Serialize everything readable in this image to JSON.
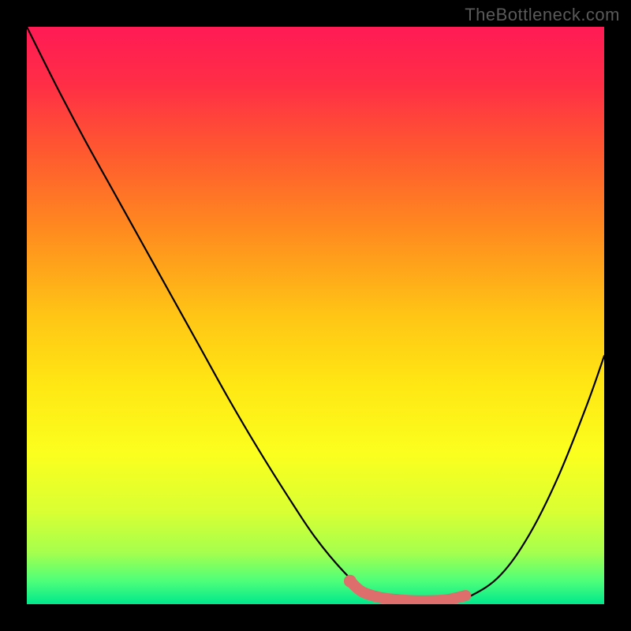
{
  "watermark": "TheBottleneck.com",
  "gradient": {
    "stops": [
      {
        "offset": 0.0,
        "color": "#ff1a55"
      },
      {
        "offset": 0.1,
        "color": "#ff2e46"
      },
      {
        "offset": 0.22,
        "color": "#ff5a2f"
      },
      {
        "offset": 0.35,
        "color": "#ff8a1f"
      },
      {
        "offset": 0.5,
        "color": "#ffc515"
      },
      {
        "offset": 0.62,
        "color": "#ffe714"
      },
      {
        "offset": 0.74,
        "color": "#fbff1e"
      },
      {
        "offset": 0.84,
        "color": "#d9ff33"
      },
      {
        "offset": 0.91,
        "color": "#a6ff4d"
      },
      {
        "offset": 0.96,
        "color": "#4dff79"
      },
      {
        "offset": 1.0,
        "color": "#00e88c"
      }
    ]
  },
  "chart_data": {
    "type": "line",
    "title": "",
    "xlabel": "",
    "ylabel": "",
    "xlim": [
      0,
      1
    ],
    "ylim": [
      0,
      1
    ],
    "series": [
      {
        "name": "curve",
        "x": [
          0.0,
          0.05,
          0.1,
          0.15,
          0.2,
          0.25,
          0.3,
          0.35,
          0.4,
          0.45,
          0.5,
          0.55,
          0.58,
          0.6,
          0.63,
          0.67,
          0.7,
          0.74,
          0.77,
          0.82,
          0.87,
          0.92,
          0.97,
          1.0
        ],
        "y": [
          1.0,
          0.9,
          0.805,
          0.715,
          0.625,
          0.535,
          0.445,
          0.355,
          0.27,
          0.19,
          0.115,
          0.055,
          0.03,
          0.02,
          0.01,
          0.006,
          0.006,
          0.008,
          0.015,
          0.05,
          0.12,
          0.22,
          0.345,
          0.43
        ]
      },
      {
        "name": "highlight",
        "x": [
          0.56,
          0.58,
          0.61,
          0.64,
          0.67,
          0.7,
          0.73,
          0.76
        ],
        "y": [
          0.04,
          0.022,
          0.012,
          0.008,
          0.006,
          0.006,
          0.008,
          0.015
        ]
      }
    ]
  }
}
